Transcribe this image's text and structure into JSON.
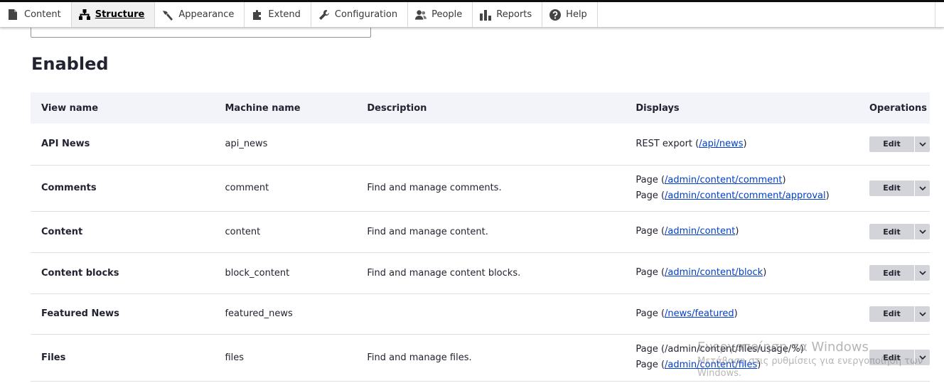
{
  "toolbar": {
    "items": [
      {
        "label": "Content",
        "icon": "content-icon"
      },
      {
        "label": "Structure",
        "icon": "structure-icon"
      },
      {
        "label": "Appearance",
        "icon": "appearance-icon"
      },
      {
        "label": "Extend",
        "icon": "extend-icon"
      },
      {
        "label": "Configuration",
        "icon": "configuration-icon"
      },
      {
        "label": "People",
        "icon": "people-icon"
      },
      {
        "label": "Reports",
        "icon": "reports-icon"
      },
      {
        "label": "Help",
        "icon": "help-icon"
      }
    ],
    "active": "Structure"
  },
  "section_title": "Enabled",
  "table": {
    "headers": [
      "View name",
      "Machine name",
      "Description",
      "Displays",
      "Operations"
    ],
    "rows": [
      {
        "name": "API News",
        "machine": "api_news",
        "description": "",
        "displays": [
          {
            "type": "REST export",
            "path": "/api/news",
            "linked": true
          }
        ],
        "edit": "Edit"
      },
      {
        "name": "Comments",
        "machine": "comment",
        "description": "Find and manage comments.",
        "displays": [
          {
            "type": "Page",
            "path": "/admin/content/comment",
            "linked": true
          },
          {
            "type": "Page",
            "path": "/admin/content/comment/approval",
            "linked": true
          }
        ],
        "edit": "Edit"
      },
      {
        "name": "Content",
        "machine": "content",
        "description": "Find and manage content.",
        "displays": [
          {
            "type": "Page",
            "path": "/admin/content",
            "linked": true
          }
        ],
        "edit": "Edit"
      },
      {
        "name": "Content blocks",
        "machine": "block_content",
        "description": "Find and manage content blocks.",
        "displays": [
          {
            "type": "Page",
            "path": "/admin/content/block",
            "linked": true
          }
        ],
        "edit": "Edit"
      },
      {
        "name": "Featured News",
        "machine": "featured_news",
        "description": "",
        "displays": [
          {
            "type": "Page",
            "path": "/news/featured",
            "linked": true
          }
        ],
        "edit": "Edit"
      },
      {
        "name": "Files",
        "machine": "files",
        "description": "Find and manage files.",
        "displays": [
          {
            "type": "Page",
            "path": "/admin/content/files/usage/%",
            "linked": false
          },
          {
            "type": "Page",
            "path": "/admin/content/files",
            "linked": true
          }
        ],
        "edit": "Edit"
      }
    ]
  },
  "watermark": {
    "line1": "Ενεργοποίηση τα Windows",
    "line2": "Μετάβαση στις ρυθμίσεις για ενεργοποίηση των",
    "line3": "Windows."
  },
  "colors": {
    "link": "#003ecc",
    "header_bg": "#f3f4f9",
    "button_bg": "#d3d4d9"
  }
}
